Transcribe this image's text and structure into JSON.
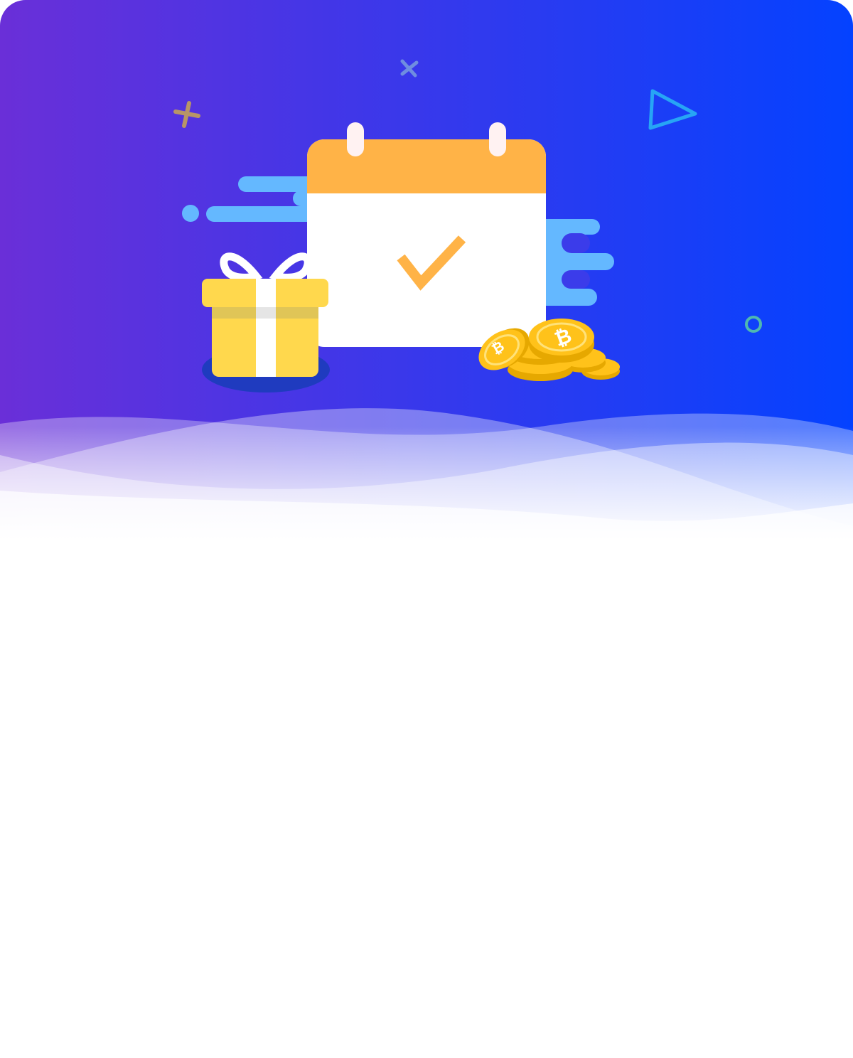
{
  "banner": {
    "gradient_start": "#6a2fd8",
    "gradient_end": "#0442ff",
    "calendar_header_color": "#ffb347",
    "checkmark_color": "#ffb347",
    "gift_color": "#ffd84d",
    "coin_color": "#ffc21a",
    "cloud_color": "#64b8ff",
    "coin_symbol": "₿"
  },
  "content": {}
}
